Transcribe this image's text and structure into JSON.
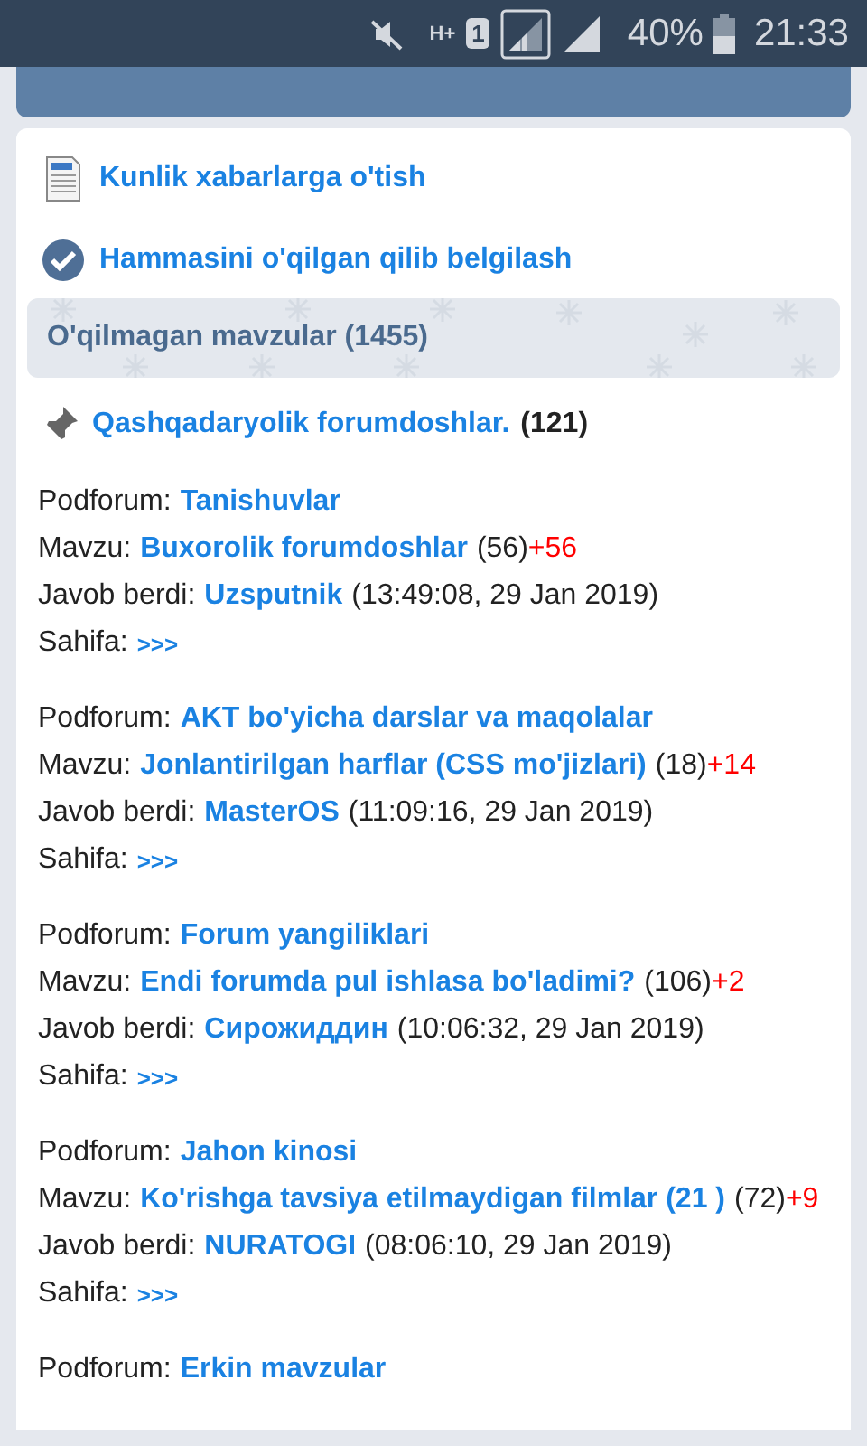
{
  "status_bar": {
    "sim": "1",
    "network": "H+",
    "battery": "40%",
    "time": "21:33"
  },
  "actions": [
    {
      "kind": "doc",
      "label": "Kunlik xabarlarga o'tish"
    },
    {
      "kind": "check",
      "label": "Hammasini o'qilgan qilib belgilash"
    }
  ],
  "section_title": "O'qilmagan mavzular (1455)",
  "pinned": {
    "title": "Qashqadaryolik forumdoshlar.",
    "count": "(121)"
  },
  "topics": [
    {
      "subforum_label": "Podforum:",
      "subforum": "Tanishuvlar",
      "topic_label": "Mavzu:",
      "topic": "Buxorolik forumdoshlar",
      "replies": "(56)",
      "new": "+56",
      "reply_label": "Javob berdi:",
      "replied_by": "Uzsputnik",
      "time": "(13:49:08, 29 Jan 2019)",
      "page_label": "Sahifa:",
      "page_link": ">>>"
    },
    {
      "subforum_label": "Podforum:",
      "subforum": "AKT bo'yicha darslar va maqolalar",
      "topic_label": "Mavzu:",
      "topic": "Jonlantirilgan harflar (CSS mo'jizlari)",
      "replies": "(18)",
      "new": "+14",
      "reply_label": "Javob berdi:",
      "replied_by": "MasterOS",
      "time": "(11:09:16, 29 Jan 2019)",
      "page_label": "Sahifa:",
      "page_link": ">>>"
    },
    {
      "subforum_label": "Podforum:",
      "subforum": "Forum yangiliklari",
      "topic_label": "Mavzu:",
      "topic": "Endi forumda pul ishlasa bo'ladimi?",
      "replies": "(106)",
      "new": "+2",
      "reply_label": "Javob berdi:",
      "replied_by": "Сирожиддин",
      "time": "(10:06:32, 29 Jan 2019)",
      "page_label": "Sahifa:",
      "page_link": ">>>"
    },
    {
      "subforum_label": "Podforum:",
      "subforum": "Jahon kinosi",
      "topic_label": "Mavzu:",
      "topic": "Ko'rishga tavsiya etilmaydigan filmlar (21 )",
      "replies": "(72)",
      "new": "+9",
      "reply_label": "Javob berdi:",
      "replied_by": "NURATOGI",
      "time": "(08:06:10, 29 Jan 2019)",
      "page_label": "Sahifa:",
      "page_link": ">>>"
    },
    {
      "subforum_label": "Podforum:",
      "subforum": "Erkin mavzular"
    }
  ]
}
